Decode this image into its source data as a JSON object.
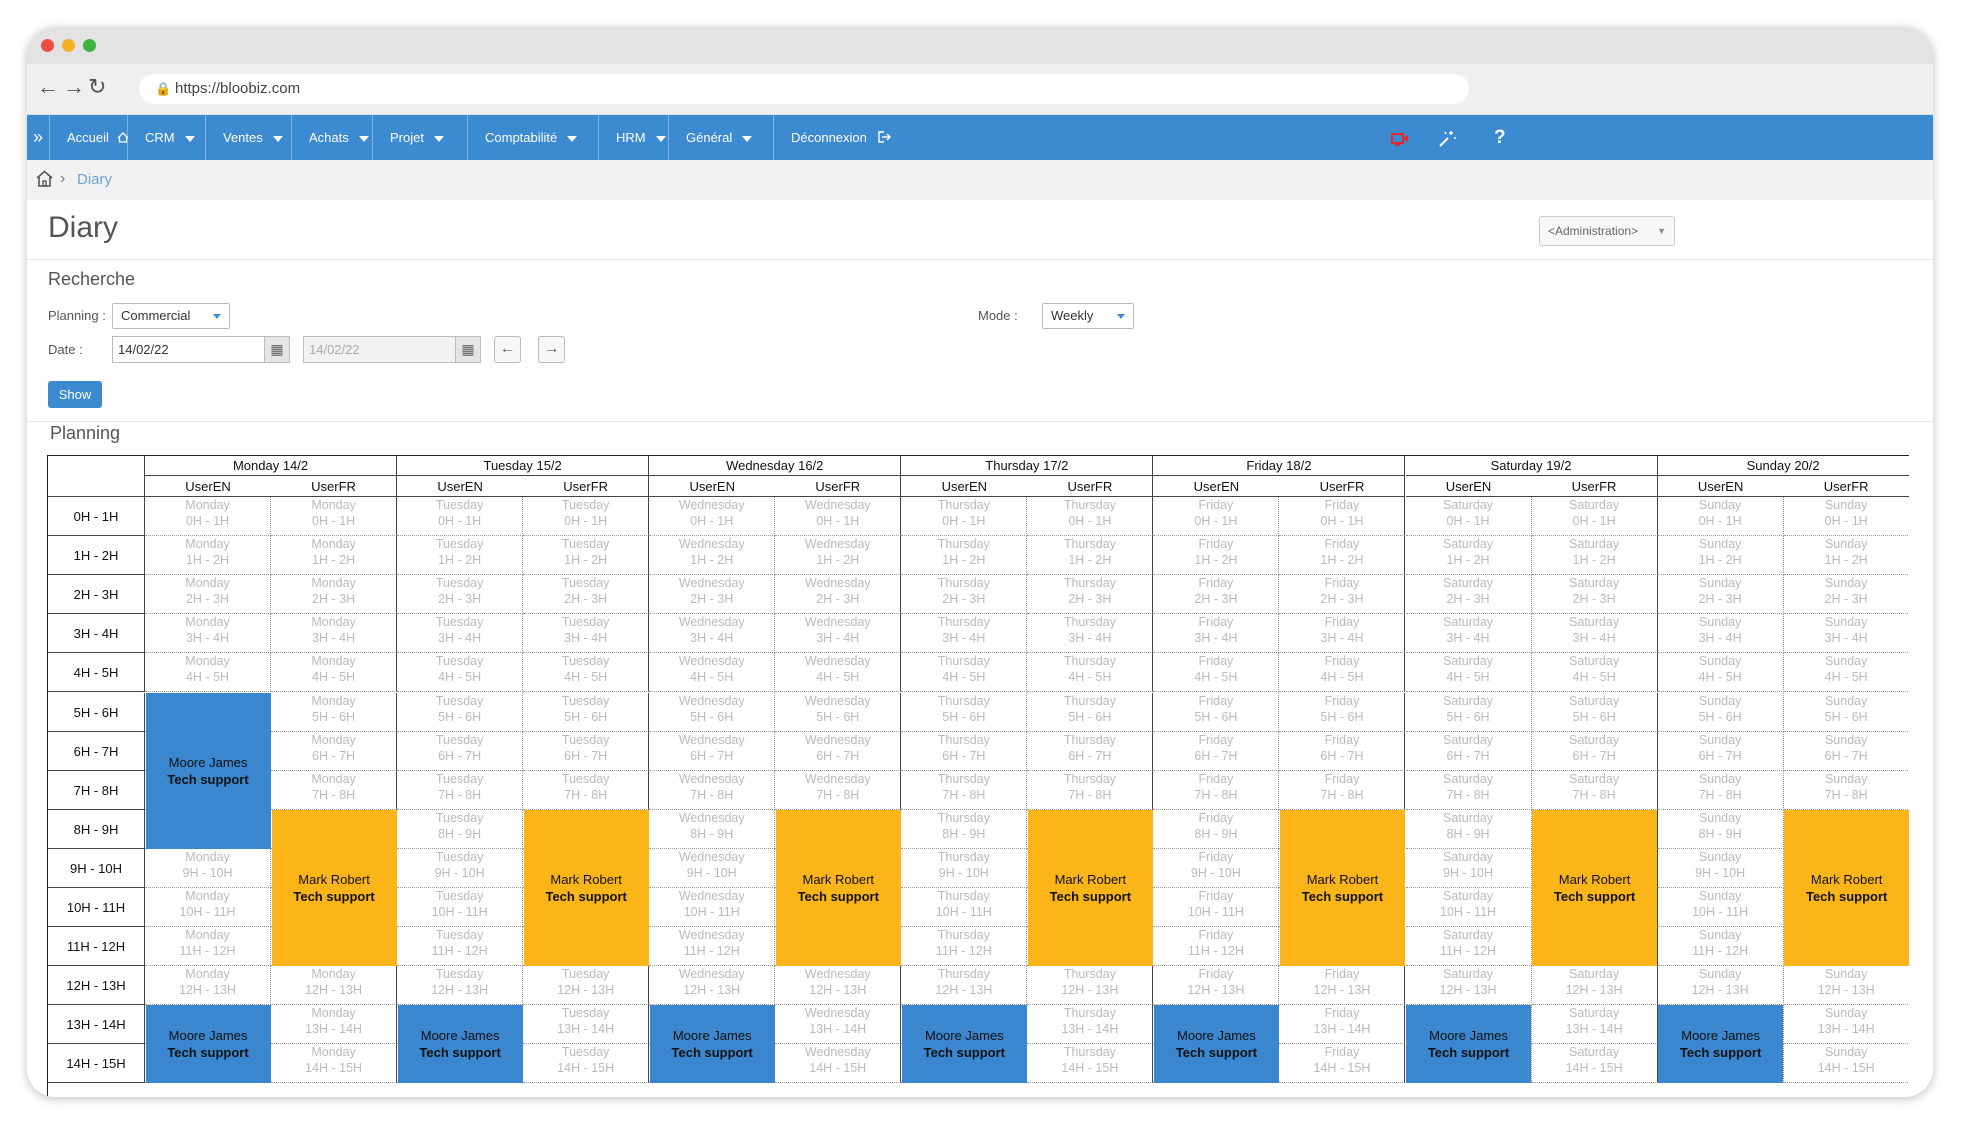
{
  "browser": {
    "url": "https://bloobiz.com",
    "traffic_colors": [
      "#ee4f42",
      "#f5b023",
      "#3fb23f"
    ]
  },
  "menu": {
    "toggle_label": "»",
    "items": [
      {
        "label": "Accueil",
        "icon": "home-icon",
        "dropdown": false
      },
      {
        "label": "CRM",
        "dropdown": true
      },
      {
        "label": "Ventes",
        "dropdown": true
      },
      {
        "label": "Achats",
        "dropdown": true
      },
      {
        "label": "Projet",
        "dropdown": true
      },
      {
        "label": "Comptabilité",
        "dropdown": true
      },
      {
        "label": "HRM",
        "dropdown": true
      },
      {
        "label": "Général",
        "dropdown": true
      },
      {
        "label": "Déconnexion",
        "icon": "logout-icon",
        "dropdown": false
      }
    ],
    "right_icons": [
      "video-icon",
      "magic-wand-icon",
      "help-icon"
    ],
    "help_label": "?"
  },
  "breadcrumb": {
    "current": "Diary"
  },
  "page": {
    "title": "Diary",
    "admin_select": "<Administration>"
  },
  "search": {
    "heading": "Recherche",
    "planning_label": "Planning :",
    "planning_value": "Commercial",
    "mode_label": "Mode :",
    "mode_value": "Weekly",
    "date_label": "Date :",
    "date_from": "14/02/22",
    "date_to": "14/02/22",
    "show_label": "Show"
  },
  "planning": {
    "heading": "Planning",
    "days": [
      {
        "label": "Monday 14/2",
        "name": "Monday"
      },
      {
        "label": "Tuesday 15/2",
        "name": "Tuesday"
      },
      {
        "label": "Wednesday 16/2",
        "name": "Wednesday"
      },
      {
        "label": "Thursday 17/2",
        "name": "Thursday"
      },
      {
        "label": "Friday 18/2",
        "name": "Friday"
      },
      {
        "label": "Saturday 19/2",
        "name": "Saturday"
      },
      {
        "label": "Sunday 20/2",
        "name": "Sunday"
      }
    ],
    "users": [
      "UserEN",
      "UserFR"
    ],
    "slots": [
      "0H - 1H",
      "1H - 2H",
      "2H - 3H",
      "3H - 4H",
      "4H - 5H",
      "5H - 6H",
      "6H - 7H",
      "7H - 8H",
      "8H - 9H",
      "9H - 10H",
      "10H - 11H",
      "11H - 12H",
      "12H - 13H",
      "13H - 14H",
      "14H - 15H"
    ],
    "events": [
      {
        "day": 0,
        "user": 0,
        "start": 5,
        "end": 9,
        "name": "Moore James",
        "desc": "Tech support",
        "color": "#3a86cf"
      },
      {
        "day": 0,
        "user": 1,
        "start": 8,
        "end": 12,
        "name": "Mark Robert",
        "desc": "Tech support",
        "color": "#fbb519"
      },
      {
        "day": 1,
        "user": 1,
        "start": 8,
        "end": 12,
        "name": "Mark Robert",
        "desc": "Tech support",
        "color": "#fbb519"
      },
      {
        "day": 2,
        "user": 1,
        "start": 8,
        "end": 12,
        "name": "Mark Robert",
        "desc": "Tech support",
        "color": "#fbb519"
      },
      {
        "day": 3,
        "user": 1,
        "start": 8,
        "end": 12,
        "name": "Mark Robert",
        "desc": "Tech support",
        "color": "#fbb519"
      },
      {
        "day": 4,
        "user": 1,
        "start": 8,
        "end": 12,
        "name": "Mark Robert",
        "desc": "Tech support",
        "color": "#fbb519"
      },
      {
        "day": 5,
        "user": 1,
        "start": 8,
        "end": 12,
        "name": "Mark Robert",
        "desc": "Tech support",
        "color": "#fbb519"
      },
      {
        "day": 6,
        "user": 1,
        "start": 8,
        "end": 12,
        "name": "Mark Robert",
        "desc": "Tech support",
        "color": "#fbb519"
      },
      {
        "day": 0,
        "user": 0,
        "start": 13,
        "end": 15,
        "name": "Moore James",
        "desc": "Tech support",
        "color": "#3a86cf"
      },
      {
        "day": 1,
        "user": 0,
        "start": 13,
        "end": 15,
        "name": "Moore James",
        "desc": "Tech support",
        "color": "#3a86cf"
      },
      {
        "day": 2,
        "user": 0,
        "start": 13,
        "end": 15,
        "name": "Moore James",
        "desc": "Tech support",
        "color": "#3a86cf"
      },
      {
        "day": 3,
        "user": 0,
        "start": 13,
        "end": 15,
        "name": "Moore James",
        "desc": "Tech support",
        "color": "#3a86cf"
      },
      {
        "day": 4,
        "user": 0,
        "start": 13,
        "end": 15,
        "name": "Moore James",
        "desc": "Tech support",
        "color": "#3a86cf"
      },
      {
        "day": 5,
        "user": 0,
        "start": 13,
        "end": 15,
        "name": "Moore James",
        "desc": "Tech support",
        "color": "#3a86cf"
      },
      {
        "day": 6,
        "user": 0,
        "start": 13,
        "end": 15,
        "name": "Moore James",
        "desc": "Tech support",
        "color": "#3a86cf"
      }
    ]
  }
}
